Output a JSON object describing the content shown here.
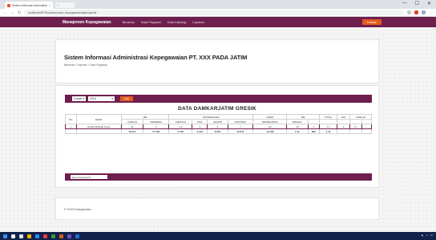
{
  "browser": {
    "tab_title": "Sistem Informasi Administrasi",
    "new_tab_label": "+",
    "url": "localhost/SIPIEcommerce/pt_kepegawaian/jatim/gresik",
    "controls": [
      "—",
      "☐",
      "✕"
    ]
  },
  "navbar": {
    "brand": "Manajemen Kepegawaian",
    "menu": [
      "Beranda",
      "Data Pegawai",
      "Data Cabang",
      "Laporan"
    ],
    "logout": "Keluar"
  },
  "header": {
    "title": "Sistem Informasi Administrasi Kepegawaian PT. XXX PADA JATIM",
    "breadcrumb": "Beranda / Laporan / Data Pegawai"
  },
  "filters": {
    "region": "Gresik",
    "year": "2016",
    "go_label": "Cari"
  },
  "table": {
    "title": "DATA DAMKARJATIM GRESIK",
    "header_top": [
      "NO",
      "NAMA",
      "JML",
      "KETERANGAN",
      "KABID",
      "JML",
      "TOTAL",
      "JML",
      "JUMLAH"
    ],
    "header_sub": [
      "JUMLAH",
      "TERSEDIA",
      "JABATAN",
      "PNS",
      "HONOR",
      "KONTRAK",
      "SEKRETARIAT",
      "BIDANG"
    ],
    "rows": [
      {
        "cells": [
          "1",
          "Gresik Wilayah Utara",
          "41",
          "0",
          "1-2",
          "3",
          "5",
          "7",
          "10",
          "13",
          "1",
          "1.1",
          "2",
          "1.1",
          "—"
        ]
      },
      {
        "cells": [
          "",
          "",
          "15.517",
          "77.163",
          "5.150",
          "4.153",
          "6.676",
          "45.071",
          "13.168",
          "1.41",
          "580",
          "1.41",
          "",
          "",
          ""
        ]
      }
    ]
  },
  "export": {
    "label": "Export ke Excel  ▾"
  },
  "footer": {
    "copyright": "© 2016 Kepegawaian"
  },
  "colors": {
    "primary": "#6e1f4e",
    "accent": "#e35b1f"
  }
}
